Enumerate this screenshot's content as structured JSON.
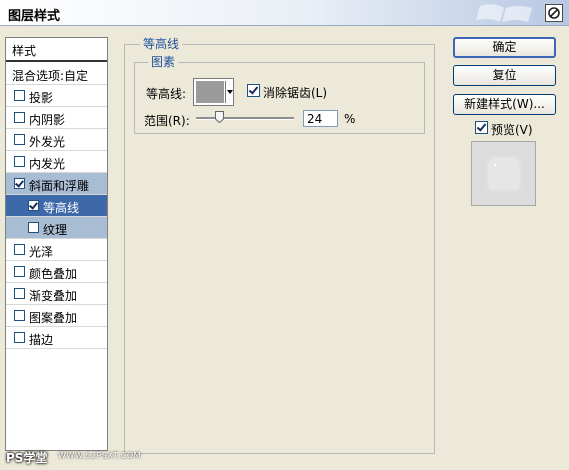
{
  "window": {
    "title": "图层样式"
  },
  "left_panel": {
    "header": "样式",
    "items": [
      {
        "label": "混合选项:自定",
        "has_checkbox": false,
        "checked": false,
        "selected": false
      },
      {
        "label": "投影",
        "has_checkbox": true,
        "checked": false
      },
      {
        "label": "内阴影",
        "has_checkbox": true,
        "checked": false
      },
      {
        "label": "外发光",
        "has_checkbox": true,
        "checked": false
      },
      {
        "label": "内发光",
        "has_checkbox": true,
        "checked": false
      },
      {
        "label": "斜面和浮雕",
        "has_checkbox": true,
        "checked": true,
        "selected": true
      },
      {
        "label": "等高线",
        "has_checkbox": true,
        "checked": true,
        "sub": true,
        "selected": true
      },
      {
        "label": "纹理",
        "has_checkbox": true,
        "checked": false,
        "sub": true
      },
      {
        "label": "光泽",
        "has_checkbox": true,
        "checked": false
      },
      {
        "label": "颜色叠加",
        "has_checkbox": true,
        "checked": false
      },
      {
        "label": "渐变叠加",
        "has_checkbox": true,
        "checked": false
      },
      {
        "label": "图案叠加",
        "has_checkbox": true,
        "checked": false
      },
      {
        "label": "描边",
        "has_checkbox": true,
        "checked": false
      }
    ]
  },
  "main": {
    "section_title": "等高线",
    "group_title": "图素",
    "contour_label": "等高线:",
    "antialias_label": "消除锯齿(L)",
    "antialias_checked": true,
    "range_label": "范围(R):",
    "range_value": "24",
    "range_unit": "%",
    "range_fraction": 0.24
  },
  "buttons": {
    "ok": "确定",
    "reset": "复位",
    "new_style": "新建样式(W)...",
    "preview_label": "预览(V)",
    "preview_checked": true
  },
  "watermark": {
    "text": "PS学堂",
    "url": "WWW.52PSXT.COM"
  }
}
